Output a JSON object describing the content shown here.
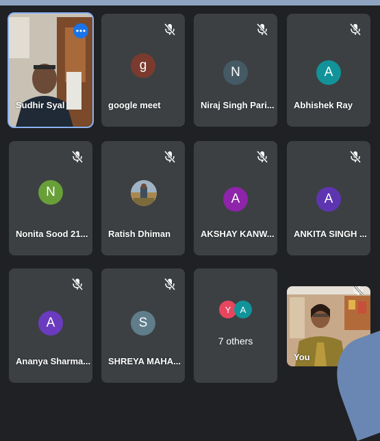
{
  "colors": {
    "tile_bg": "#3c4043",
    "page_bg": "#202124",
    "active_outline": "#8ab4f8"
  },
  "tiles": [
    {
      "name": "Sudhir Syal",
      "type": "video",
      "active": true
    },
    {
      "name": "google meet",
      "initial": "g",
      "avatar_color": "#7a3b2e",
      "muted": true
    },
    {
      "name": "Niraj Singh Pari...",
      "initial": "N",
      "avatar_color": "#455a64",
      "muted": true
    },
    {
      "name": "Abhishek Ray",
      "initial": "A",
      "avatar_color": "#12939a",
      "muted": true
    },
    {
      "name": "Nonita Sood 21...",
      "initial": "N",
      "avatar_color": "#689f38",
      "muted": true
    },
    {
      "name": "Ratish Dhiman",
      "type": "photo",
      "muted": true
    },
    {
      "name": "AKSHAY KANW...",
      "initial": "A",
      "avatar_color": "#8e24aa",
      "muted": true
    },
    {
      "name": "ANKITA SINGH ...",
      "initial": "A",
      "avatar_color": "#5e35b1",
      "muted": true
    },
    {
      "name": "Ananya Sharma...",
      "initial": "A",
      "avatar_color": "#6a3bbf",
      "muted": true
    },
    {
      "name": "SHREYA MAHA...",
      "initial": "S",
      "avatar_color": "#607d8b",
      "muted": true
    },
    {
      "others_label": "7 others",
      "initials": [
        "Y",
        "A"
      ],
      "colors": [
        "#e8465e",
        "#12939a"
      ]
    },
    {
      "name": "You",
      "type": "video",
      "muted": true
    }
  ]
}
